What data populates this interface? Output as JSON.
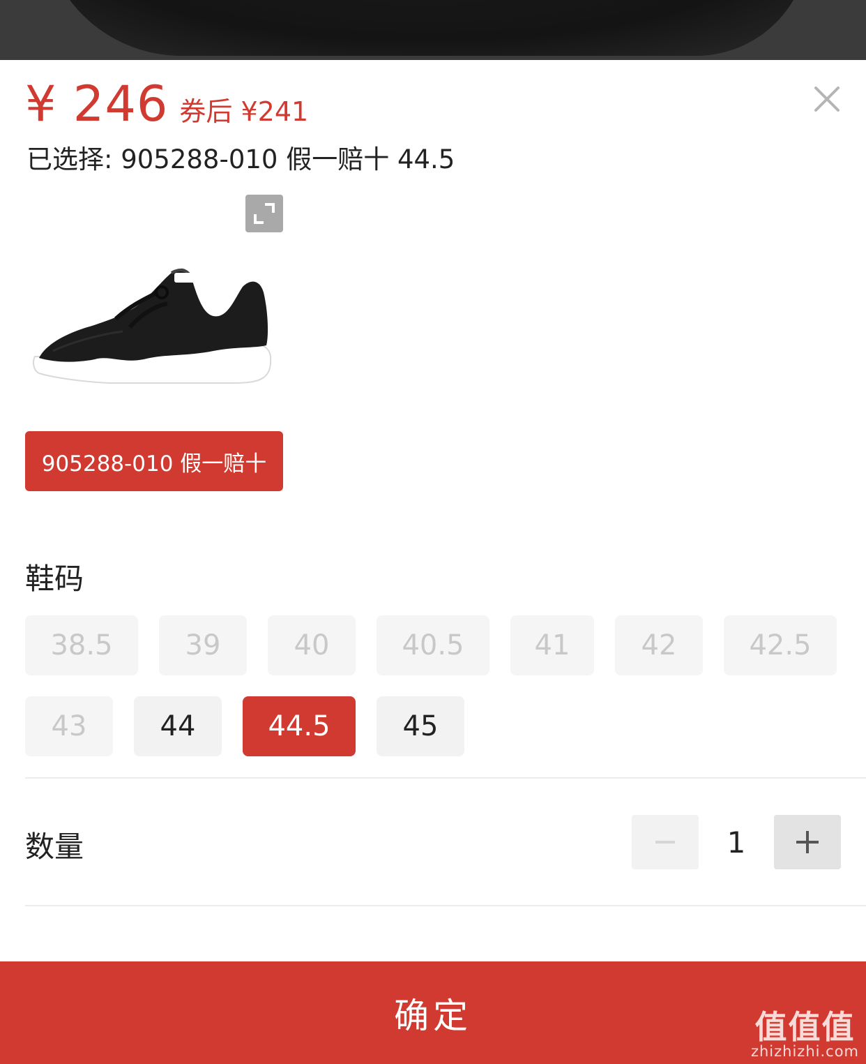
{
  "colors": {
    "accent": "#d13a30",
    "disabled_text": "#c8c8c8",
    "chip_bg": "#f2f2f2"
  },
  "price": {
    "main": "¥ 246",
    "coupon": "券后 ¥241"
  },
  "selection": {
    "text": "已选择: 905288-010 假一赔十 44.5"
  },
  "variant": {
    "label": "905288-010 假一赔十"
  },
  "size_section": {
    "title": "鞋码",
    "sizes": [
      {
        "label": "38.5",
        "state": "disabled"
      },
      {
        "label": "39",
        "state": "disabled"
      },
      {
        "label": "40",
        "state": "disabled"
      },
      {
        "label": "40.5",
        "state": "disabled"
      },
      {
        "label": "41",
        "state": "disabled"
      },
      {
        "label": "42",
        "state": "disabled"
      },
      {
        "label": "42.5",
        "state": "disabled"
      },
      {
        "label": "43",
        "state": "disabled"
      },
      {
        "label": "44",
        "state": "available"
      },
      {
        "label": "44.5",
        "state": "selected"
      },
      {
        "label": "45",
        "state": "available"
      }
    ]
  },
  "quantity": {
    "title": "数量",
    "value": "1"
  },
  "confirm": {
    "label": "确定"
  },
  "watermark": {
    "main": "值值值",
    "sub": "zhizhizhi.com"
  },
  "icons": [
    "close-icon",
    "expand-icon",
    "minus-icon",
    "plus-icon"
  ]
}
